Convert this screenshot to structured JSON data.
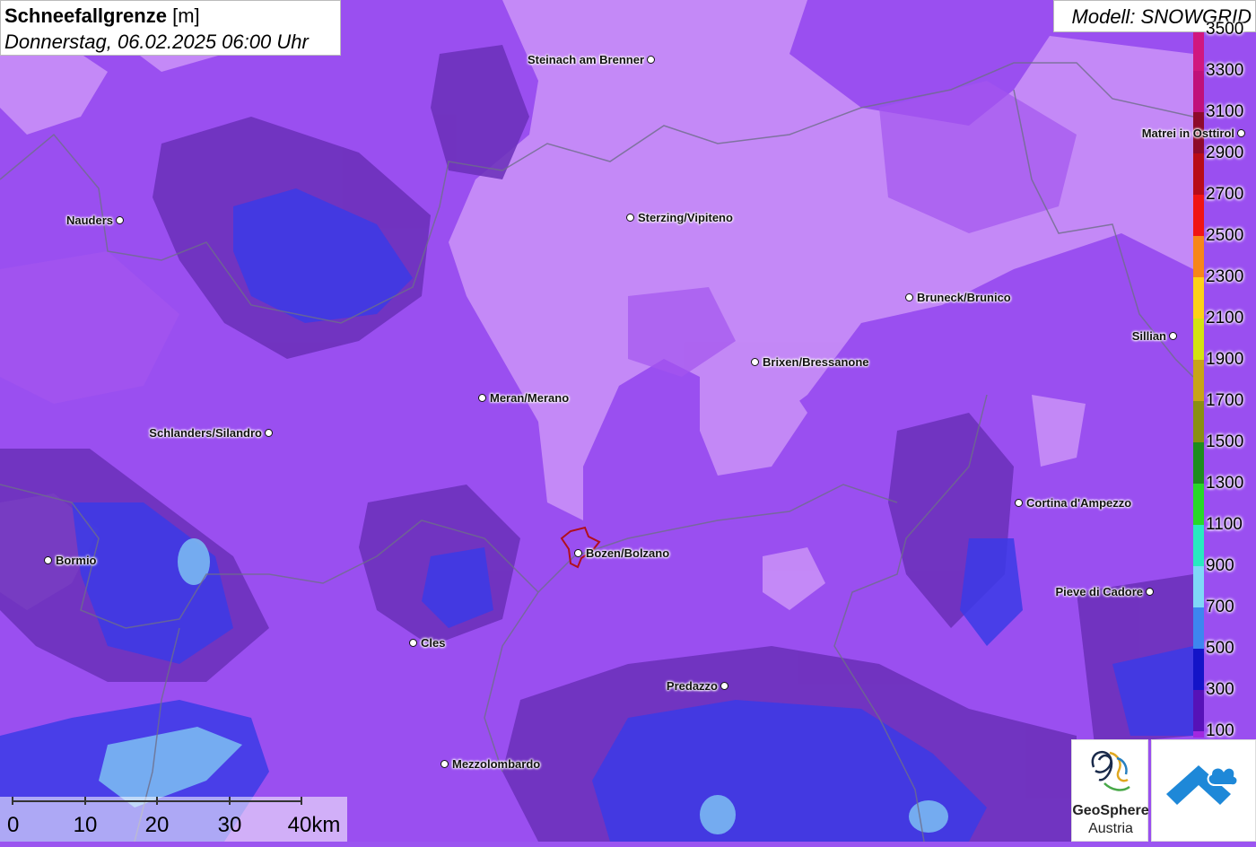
{
  "header": {
    "title_bold": "Schneefallgrenze",
    "title_unit": "[m]",
    "datetime": "Donnerstag, 06.02.2025 06:00 Uhr"
  },
  "model": {
    "label": "Modell: SNOWGRID"
  },
  "legend": {
    "levels": [
      {
        "label": "3500",
        "color": "#d0177f"
      },
      {
        "label": "3300",
        "color": "#c0107a"
      },
      {
        "label": "3100",
        "color": "#8e0a2c"
      },
      {
        "label": "2900",
        "color": "#b80c18"
      },
      {
        "label": "2700",
        "color": "#f01414"
      },
      {
        "label": "2500",
        "color": "#f7861a"
      },
      {
        "label": "2300",
        "color": "#fdd117"
      },
      {
        "label": "2100",
        "color": "#d4e211"
      },
      {
        "label": "1900",
        "color": "#c8a418"
      },
      {
        "label": "1700",
        "color": "#8a8f12"
      },
      {
        "label": "1500",
        "color": "#1e8c1e"
      },
      {
        "label": "1300",
        "color": "#28d828"
      },
      {
        "label": "1100",
        "color": "#28eac0"
      },
      {
        "label": "900",
        "color": "#7fd8f8"
      },
      {
        "label": "700",
        "color": "#3d86f0"
      },
      {
        "label": "500",
        "color": "#1414c8"
      },
      {
        "label": "300",
        "color": "#5612b8"
      },
      {
        "label": "100",
        "color": "#a028e0"
      }
    ],
    "bottom_color": "#c05cf2"
  },
  "cities": [
    {
      "name": "Steinach am Brenner",
      "label_side": "left"
    },
    {
      "name": "Matrei in Osttirol",
      "label_side": "left"
    },
    {
      "name": "Nauders",
      "label_side": "left"
    },
    {
      "name": "Sterzing/Vipiteno",
      "label_side": "right"
    },
    {
      "name": "Bruneck/Brunico",
      "label_side": "right"
    },
    {
      "name": "Sillian",
      "label_side": "left"
    },
    {
      "name": "Brixen/Bressanone",
      "label_side": "right"
    },
    {
      "name": "Meran/Merano",
      "label_side": "right"
    },
    {
      "name": "Schlanders/Silandro",
      "label_side": "left"
    },
    {
      "name": "Cortina d'Ampezzo",
      "label_side": "right"
    },
    {
      "name": "Bormio",
      "label_side": "right"
    },
    {
      "name": "Bozen/Bolzano",
      "label_side": "right"
    },
    {
      "name": "Pieve di Cadore",
      "label_side": "left"
    },
    {
      "name": "Cles",
      "label_side": "right"
    },
    {
      "name": "Predazzo",
      "label_side": "left"
    },
    {
      "name": "Mezzolombardo",
      "label_side": "right"
    }
  ],
  "scalebar": {
    "labels": [
      "0",
      "10",
      "20",
      "30",
      "40km"
    ]
  },
  "logos": {
    "geosphere_line1": "GeoSphere",
    "geosphere_line2": "Austria"
  }
}
